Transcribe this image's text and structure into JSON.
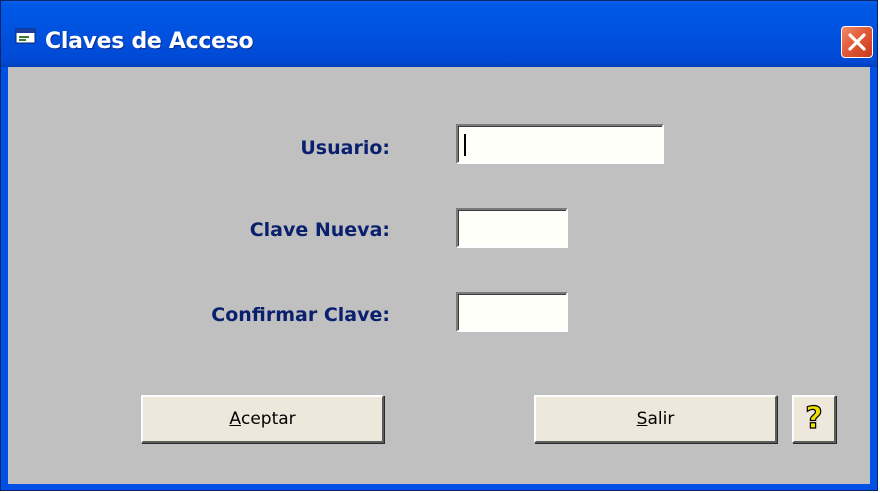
{
  "window": {
    "title": "Claves de Acceso",
    "title_icon": "window-icon",
    "close_icon": "close-icon"
  },
  "form": {
    "usuario": {
      "label": "Usuario:",
      "value": ""
    },
    "clave_nueva": {
      "label": "Clave Nueva:",
      "value": ""
    },
    "confirmar_clave": {
      "label": "Confirmar Clave:",
      "value": ""
    }
  },
  "buttons": {
    "aceptar": {
      "accel": "A",
      "rest": "ceptar"
    },
    "salir": {
      "accel": "S",
      "rest": "alir"
    },
    "help": {
      "label": "?",
      "icon": "help-icon"
    }
  },
  "colors": {
    "titlebar": "#0051df",
    "client_bg": "#c0c0c0",
    "label_text": "#0a1f6e",
    "close_button": "#e25b39",
    "help_glyph": "#f2e000"
  }
}
